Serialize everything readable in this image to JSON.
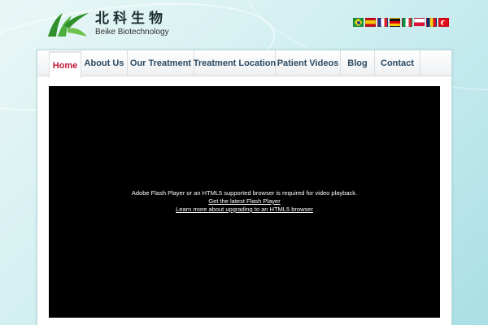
{
  "header": {
    "logo_cn": "北科生物",
    "logo_en": "Beike Biotechnology"
  },
  "language_flags": [
    {
      "icon": "flag-brazil-icon",
      "language": "Portuguese"
    },
    {
      "icon": "flag-spain-icon",
      "language": "Spanish"
    },
    {
      "icon": "flag-france-icon",
      "language": "French"
    },
    {
      "icon": "flag-germany-icon",
      "language": "German"
    },
    {
      "icon": "flag-italy-icon",
      "language": "Italian"
    },
    {
      "icon": "flag-poland-icon",
      "language": "Polish"
    },
    {
      "icon": "flag-romania-icon",
      "language": "Romanian"
    },
    {
      "icon": "flag-turkey-icon",
      "language": "Turkish"
    }
  ],
  "nav": {
    "items": [
      {
        "label": "Home",
        "active": true
      },
      {
        "label": "About Us",
        "active": false
      },
      {
        "label": "Our Treatment",
        "active": false
      },
      {
        "label": "Treatment Location",
        "active": false
      },
      {
        "label": "Patient Videos",
        "active": false
      },
      {
        "label": "Blog",
        "active": false
      },
      {
        "label": "Contact",
        "active": false
      }
    ]
  },
  "video": {
    "message": "Adobe Flash Player or an HTML5 supported browser is required for video playback.",
    "link_flash": "Get the latest Flash Player",
    "link_html5": "Learn more about upgrading to an HTML5 browser"
  },
  "colors": {
    "nav_active": "#c0193a",
    "nav_text": "#2b4a63",
    "logo_green": "#2f8f2a",
    "video_bg": "#000000"
  }
}
